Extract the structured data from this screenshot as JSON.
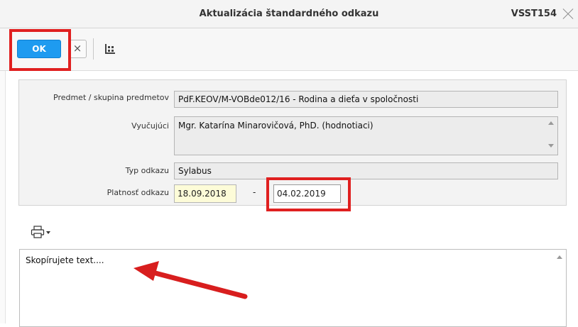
{
  "window": {
    "title": "Aktualizácia štandardného odkazu",
    "code": "VSST154"
  },
  "toolbar": {
    "ok_label": "OK",
    "cancel_glyph": "×"
  },
  "form": {
    "subject_label": "Predmet / skupina predmetov",
    "subject_value": "PdF.KEOV/M-VOBde012/16 - Rodina a dieťa v spoločnosti",
    "teacher_label": "Vyučujúci",
    "teacher_value": "Mgr. Katarína Minarovičová, PhD. (hodnotiaci)",
    "type_label": "Typ odkazu",
    "type_value": "Sylabus",
    "validity_label": "Platnosť odkazu",
    "validity_from": "18.09.2018",
    "validity_sep": "-",
    "validity_to": "04.02.2019"
  },
  "editor": {
    "text": "Skopírujete text...."
  },
  "colors": {
    "ok_button": "#1e9bf0",
    "highlight": "#e02020",
    "date_from_bg": "#fdfcd8"
  },
  "icons": {
    "close": "close-icon",
    "grid": "grid-icon",
    "print": "print-icon",
    "annotation": "arrow-annotation"
  }
}
